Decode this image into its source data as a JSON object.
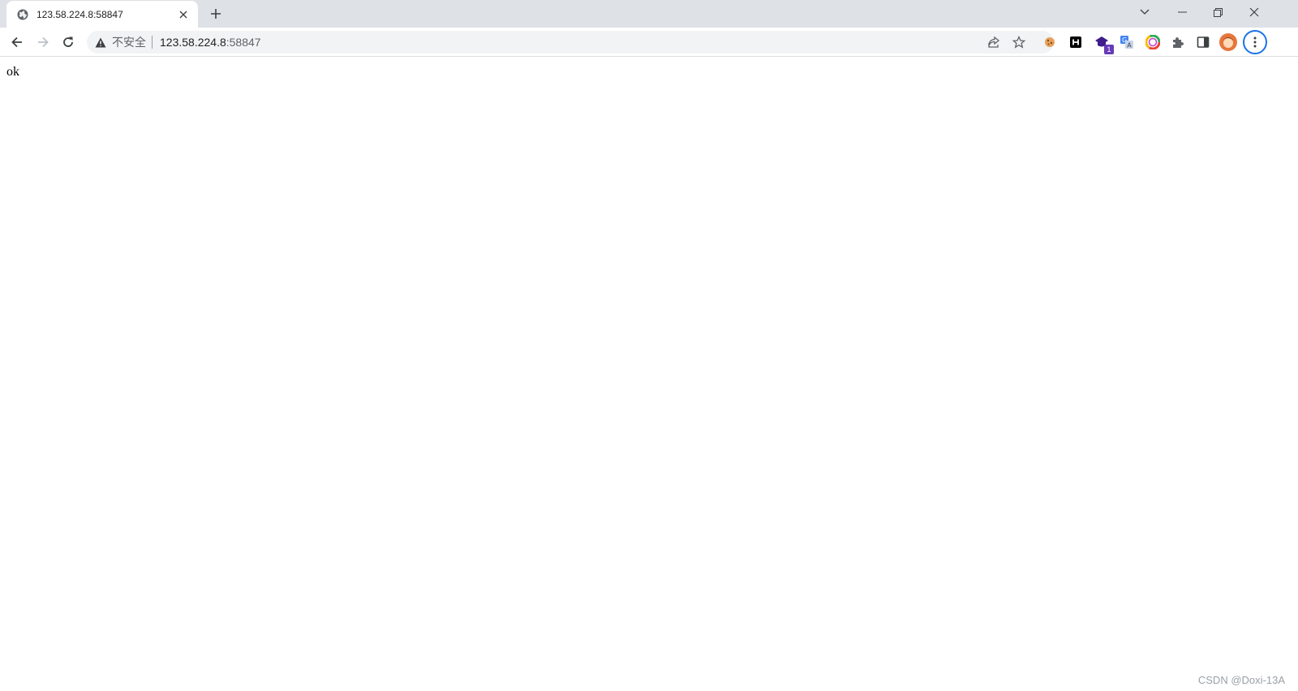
{
  "tab": {
    "title": "123.58.224.8:58847",
    "favicon": "globe-icon"
  },
  "window_controls": [
    "tab-search-icon",
    "minimize-icon",
    "restore-icon",
    "close-icon"
  ],
  "address_bar": {
    "security_label": "不安全",
    "url_host": "123.58.224.8",
    "url_port": ":58847"
  },
  "toolbar_icons": [
    "back-icon",
    "forward-icon",
    "reload-icon",
    "share-icon",
    "bookmark-star-icon"
  ],
  "extensions": {
    "badge_count": "1",
    "items": [
      "cookie-extension-icon",
      "h-extension-icon",
      "purple-extension-icon",
      "translate-extension-icon",
      "chrome-color-extension-icon",
      "puzzle-icon",
      "side-panel-icon",
      "profile-avatar",
      "menu-kebab-icon"
    ]
  },
  "page": {
    "body_text": "ok"
  },
  "watermark": "CSDN @Doxi-13A",
  "colors": {
    "tabstrip": "#dee1e6",
    "omnibox": "#f1f3f4",
    "menu_ring": "#1a73e8"
  }
}
